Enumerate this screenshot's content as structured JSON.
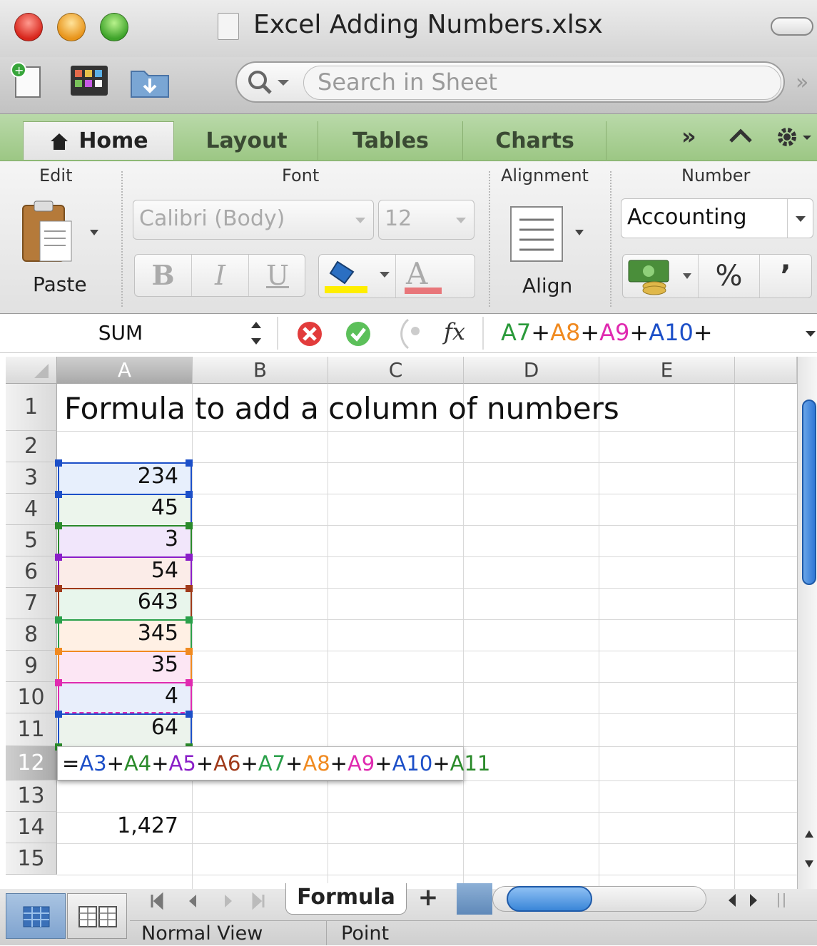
{
  "window": {
    "title": "Excel Adding Numbers.xlsx",
    "search_placeholder": "Search in Sheet"
  },
  "ribbon_tabs": [
    "Home",
    "Layout",
    "Tables",
    "Charts"
  ],
  "ribbon_groups": {
    "edit": "Edit",
    "font": "Font",
    "alignment": "Alignment",
    "number": "Number"
  },
  "ribbon": {
    "paste_label": "Paste",
    "font_name": "Calibri (Body)",
    "font_size": "12",
    "bold": "B",
    "italic": "I",
    "underline": "U",
    "font_color_glyph": "A",
    "align_label": "Align",
    "number_format": "Accounting",
    "percent_glyph": "%",
    "comma_glyph": "ʼ",
    "fill_color": "#ffee00",
    "font_color": "#e8767a"
  },
  "formula_bar": {
    "name_box": "SUM",
    "fx": "fx",
    "formula_tokens": [
      {
        "text": "A7",
        "color": "#2a9a3a"
      },
      {
        "text": "+",
        "color": "#111111"
      },
      {
        "text": "A8",
        "color": "#f08a20"
      },
      {
        "text": "+",
        "color": "#111111"
      },
      {
        "text": "A9",
        "color": "#e02ab0"
      },
      {
        "text": "+",
        "color": "#111111"
      },
      {
        "text": "A10",
        "color": "#1c4fc8"
      },
      {
        "text": "+",
        "color": "#111111"
      }
    ]
  },
  "columns": [
    "A",
    "B",
    "C",
    "D",
    "E"
  ],
  "rows": [
    "1",
    "2",
    "3",
    "4",
    "5",
    "6",
    "7",
    "8",
    "9",
    "10",
    "11",
    "12",
    "13",
    "14",
    "15"
  ],
  "sheet": {
    "a1": "Formula to add a column of numbers",
    "values": [
      "234",
      "45",
      "3",
      "54",
      "643",
      "345",
      "35",
      "4",
      "64"
    ],
    "range_colors": [
      "#1c4fc8",
      "#1c4fc8",
      "#2a8a2a",
      "#8a1ec8",
      "#a03a1a",
      "#2aa04a",
      "#f08a20",
      "#e02ab0",
      "#1c4fc8",
      "#2a8a2a"
    ],
    "band_colors": [
      "#e7effc",
      "#ecf5ec",
      "#f1e6fb",
      "#fbece8",
      "#e8f6ec",
      "#fff0e4",
      "#fce6f4",
      "#e8eefb",
      "#ecf3ec"
    ],
    "cell_editor_tokens": [
      {
        "text": "=",
        "color": "#111111"
      },
      {
        "text": "A3",
        "color": "#1c4fc8"
      },
      {
        "text": "+",
        "color": "#111111"
      },
      {
        "text": "A4",
        "color": "#2a8a2a"
      },
      {
        "text": "+",
        "color": "#111111"
      },
      {
        "text": "A5",
        "color": "#8a1ec8"
      },
      {
        "text": "+",
        "color": "#111111"
      },
      {
        "text": "A6",
        "color": "#a03a1a"
      },
      {
        "text": "+",
        "color": "#111111"
      },
      {
        "text": "A7",
        "color": "#2aa04a"
      },
      {
        "text": "+",
        "color": "#111111"
      },
      {
        "text": "A8",
        "color": "#f08a20"
      },
      {
        "text": "+",
        "color": "#111111"
      },
      {
        "text": "A9",
        "color": "#e02ab0"
      },
      {
        "text": "+",
        "color": "#111111"
      },
      {
        "text": "A10",
        "color": "#1c4fc8"
      },
      {
        "text": "+",
        "color": "#111111"
      },
      {
        "text": "A11",
        "color": "#2a8a2a"
      }
    ],
    "a14": "1,427"
  },
  "sheet_tabs": {
    "active": "Formula",
    "add": "+"
  },
  "status_bar": {
    "view": "Normal View",
    "mode": "Point"
  }
}
